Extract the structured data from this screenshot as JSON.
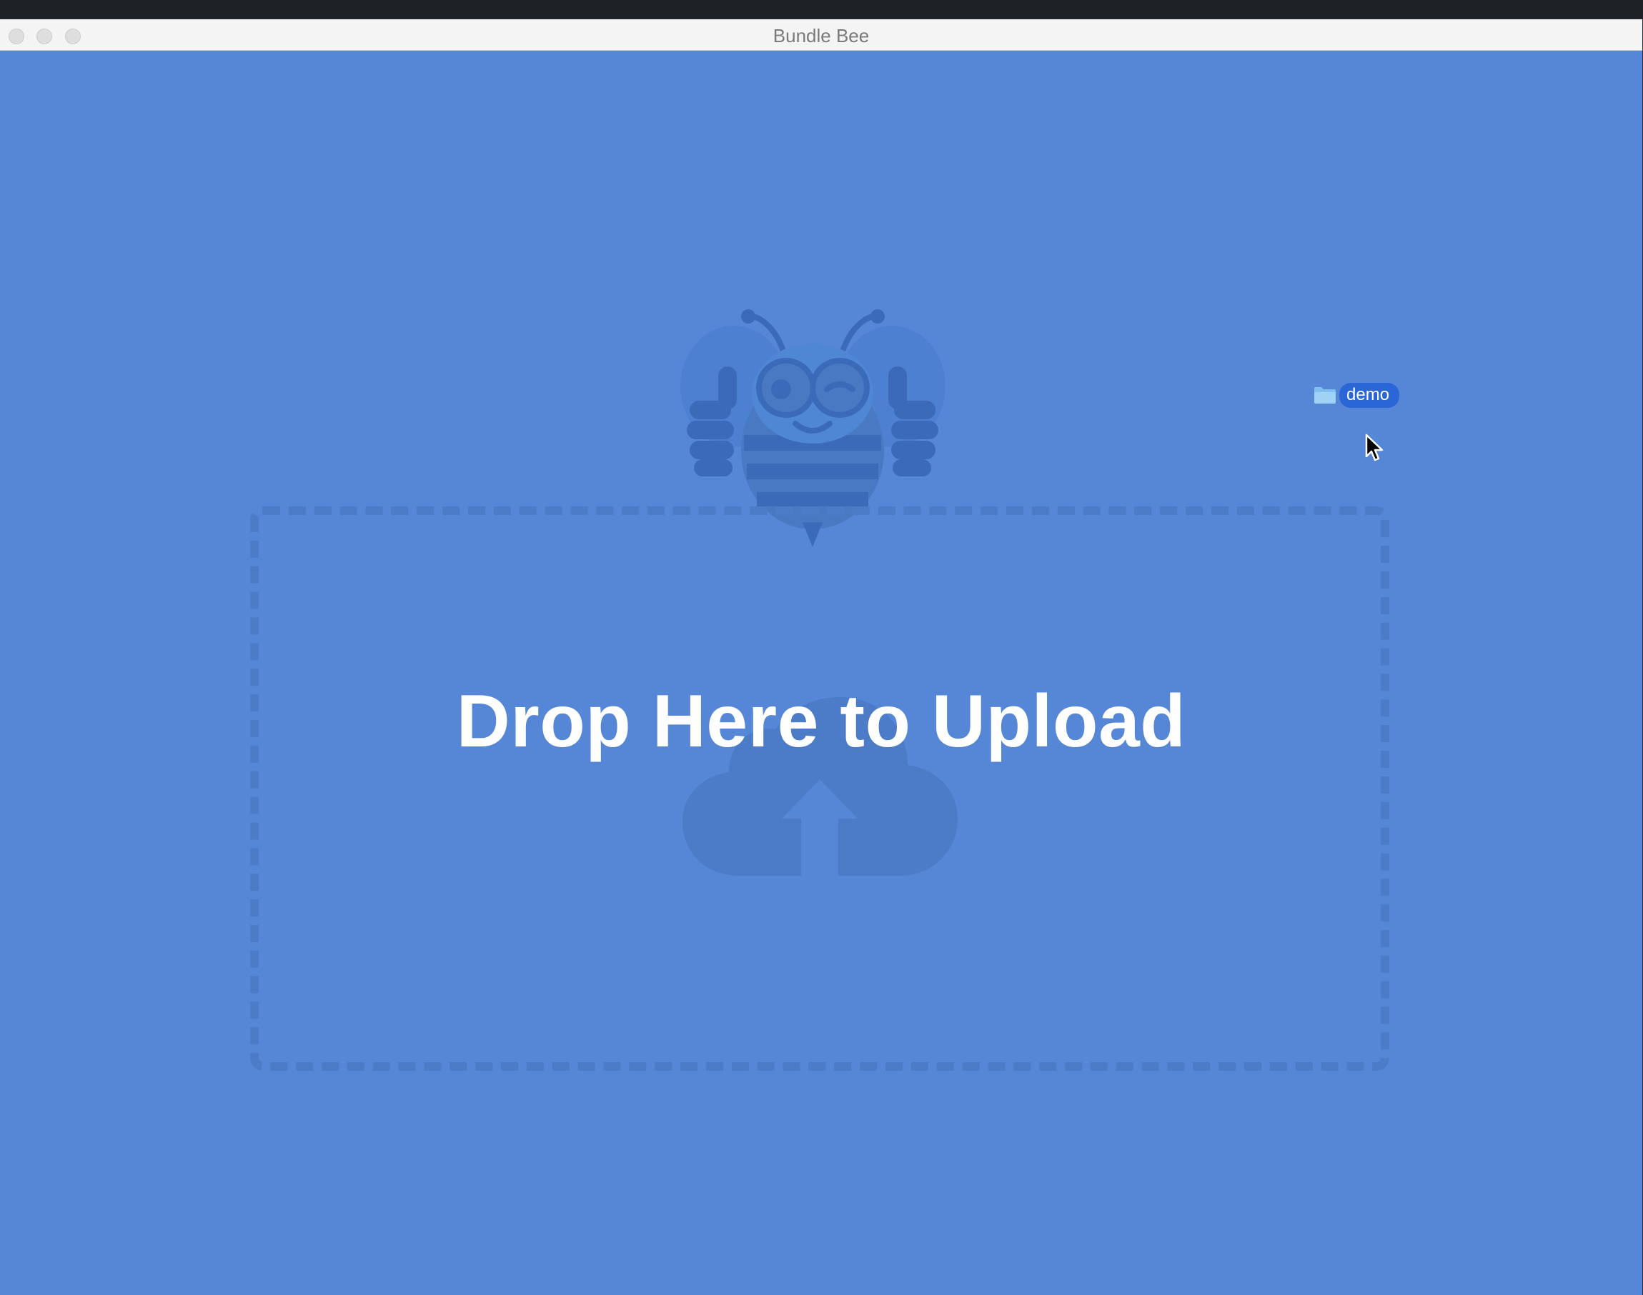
{
  "window": {
    "title": "Bundle Bee"
  },
  "drop_zone": {
    "heading": "Drop Here to Upload"
  },
  "drag_item": {
    "label": "demo",
    "icon": "folder-icon"
  },
  "colors": {
    "background": "#5587d6",
    "accent_dark": "#2b66d6",
    "titlebar": "#f4f4f4"
  }
}
